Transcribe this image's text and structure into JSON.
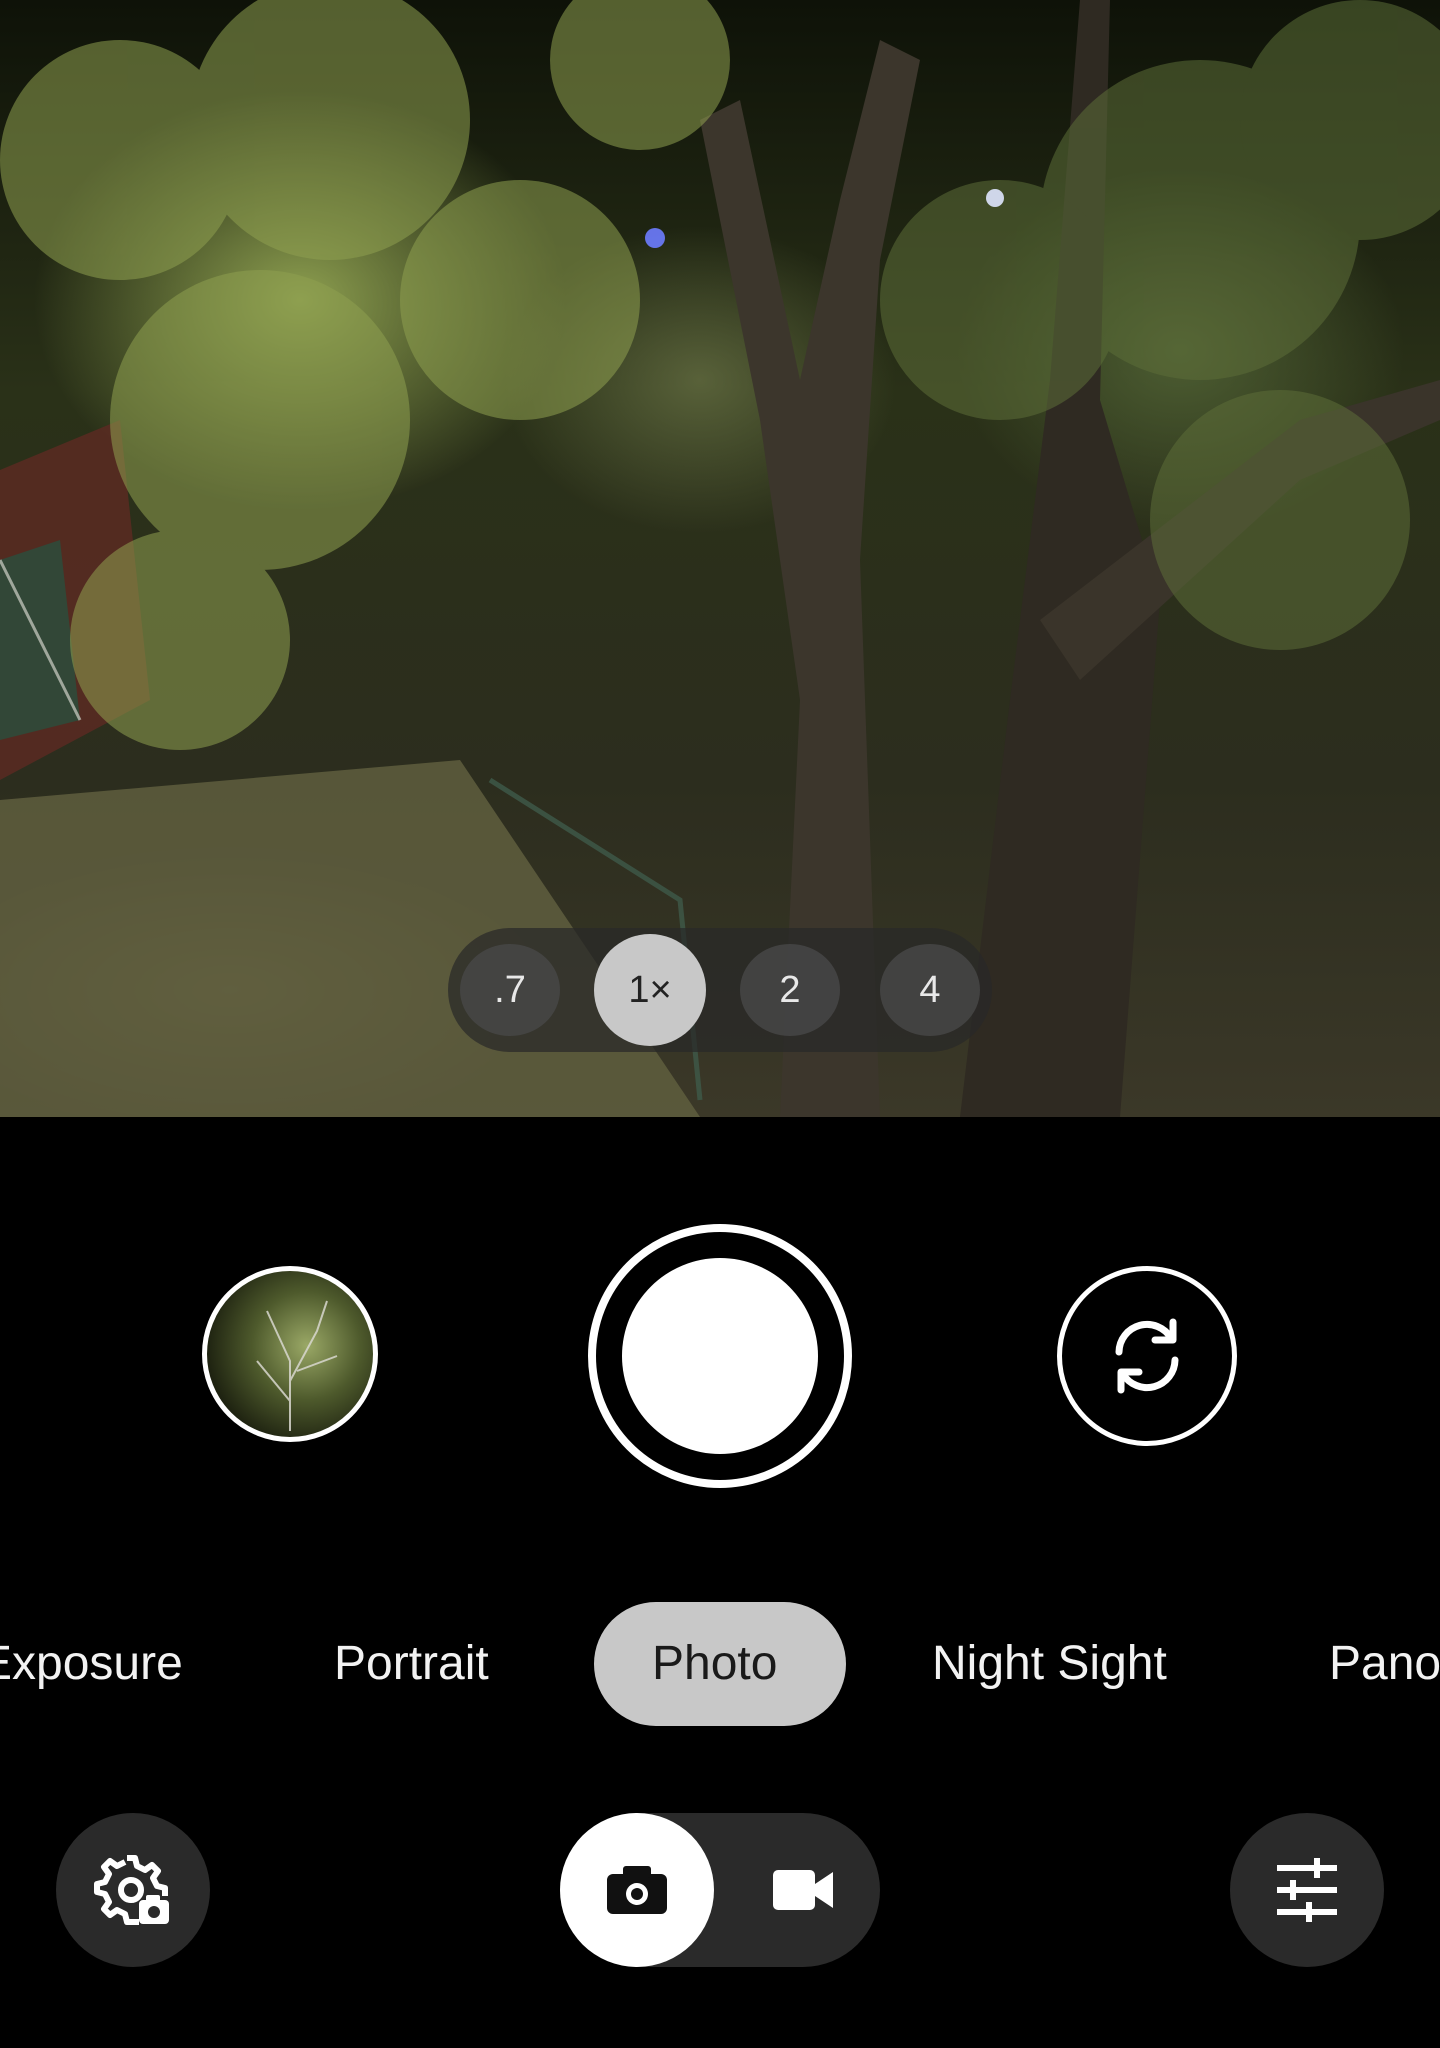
{
  "zoom": {
    "options": [
      ".7",
      "1×",
      "2",
      "4"
    ],
    "selected": "1×"
  },
  "capture": {
    "last_photo_icon": "gallery-thumbnail",
    "shutter_icon": "shutter-button",
    "switch_camera_icon": "flip-camera-icon"
  },
  "modes": {
    "items": [
      "Exposure",
      "Portrait",
      "Photo",
      "Night Sight",
      "Pano"
    ],
    "selected": "Photo"
  },
  "bottom_bar": {
    "settings_icon": "camera-settings-icon",
    "photo_mode_icon": "camera-icon",
    "video_mode_icon": "video-camera-icon",
    "adjust_icon": "sliders-icon",
    "selected_capture_type": "photo"
  },
  "colors": {
    "background": "#000000",
    "selected_chip": "#c8c8c8",
    "button_dark": "#2a2a2a",
    "foreground": "#ffffff"
  }
}
